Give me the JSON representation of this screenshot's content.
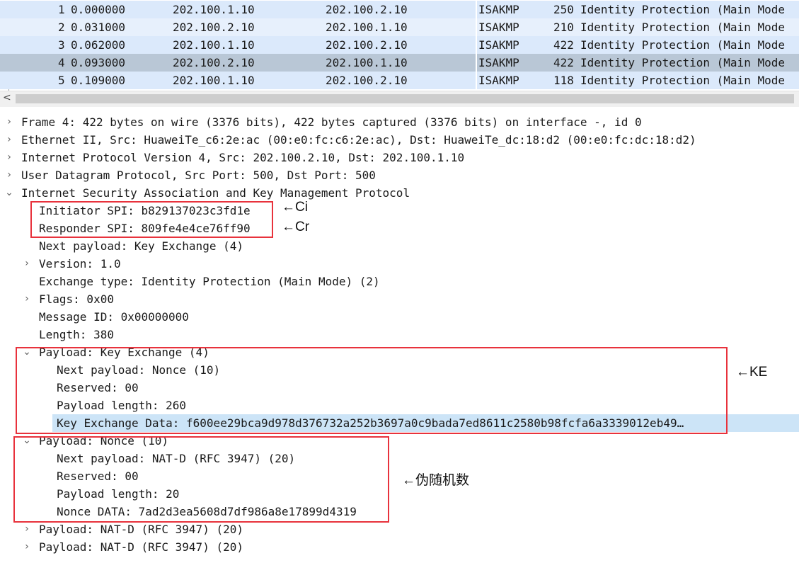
{
  "packet_list": {
    "rows": [
      {
        "no": "1",
        "time": "0.000000",
        "source": "202.100.1.10",
        "destination": "202.100.2.10",
        "protocol": "ISAKMP",
        "length": "250",
        "info": "Identity Protection (Main Mode"
      },
      {
        "no": "2",
        "time": "0.031000",
        "source": "202.100.2.10",
        "destination": "202.100.1.10",
        "protocol": "ISAKMP",
        "length": "210",
        "info": "Identity Protection (Main Mode"
      },
      {
        "no": "3",
        "time": "0.062000",
        "source": "202.100.1.10",
        "destination": "202.100.2.10",
        "protocol": "ISAKMP",
        "length": "422",
        "info": "Identity Protection (Main Mode"
      },
      {
        "no": "4",
        "time": "0.093000",
        "source": "202.100.2.10",
        "destination": "202.100.1.10",
        "protocol": "ISAKMP",
        "length": "422",
        "info": "Identity Protection (Main Mode"
      },
      {
        "no": "5",
        "time": "0.109000",
        "source": "202.100.1.10",
        "destination": "202.100.2.10",
        "protocol": "ISAKMP",
        "length": "118",
        "info": "Identity Protection (Main Mode"
      }
    ],
    "selected_row": 4
  },
  "scrollbar": {
    "left_arrow_icon": "chevron-left-icon"
  },
  "detail": {
    "frame": "Frame 4: 422 bytes on wire (3376 bits), 422 bytes captured (3376 bits) on interface -, id 0",
    "ethernet": "Ethernet II, Src: HuaweiTe_c6:2e:ac (00:e0:fc:c6:2e:ac), Dst: HuaweiTe_dc:18:d2 (00:e0:fc:dc:18:d2)",
    "ip": "Internet Protocol Version 4, Src: 202.100.2.10, Dst: 202.100.1.10",
    "udp": "User Datagram Protocol, Src Port: 500, Dst Port: 500",
    "isakmp": "Internet Security Association and Key Management Protocol",
    "initiator_spi": "Initiator SPI: b829137023c3fd1e",
    "responder_spi": "Responder SPI: 809fe4e4ce76ff90",
    "next_payload": "Next payload: Key Exchange (4)",
    "version": "Version: 1.0",
    "exchange_type": "Exchange type: Identity Protection (Main Mode) (2)",
    "flags": "Flags: 0x00",
    "message_id": "Message ID: 0x00000000",
    "length": "Length: 380",
    "ke_payload": {
      "title": "Payload: Key Exchange (4)",
      "next_payload": "Next payload: Nonce (10)",
      "reserved": "Reserved: 00",
      "payload_length": "Payload length: 260",
      "data": "Key Exchange Data: f600ee29bca9d978d376732a252b3697a0c9bada7ed8611c2580b98fcfa6a3339012eb49…"
    },
    "nonce_payload": {
      "title": "Payload: Nonce (10)",
      "next_payload": "Next payload: NAT-D (RFC 3947) (20)",
      "reserved": "Reserved: 00",
      "payload_length": "Payload length: 20",
      "data": "Nonce DATA: 7ad2d3ea5608d7df986a8e17899d4319"
    },
    "natd_1": "Payload: NAT-D (RFC 3947) (20)",
    "natd_2": "Payload: NAT-D (RFC 3947) (20)"
  },
  "annotations": {
    "ci": "←Ci",
    "cr": "←Cr",
    "ke": "←KE",
    "nonce": "←伪随机数",
    "color": "#e8323c"
  },
  "icons": {
    "collapsed": "chevron-right-icon",
    "expanded": "chevron-down-icon"
  }
}
